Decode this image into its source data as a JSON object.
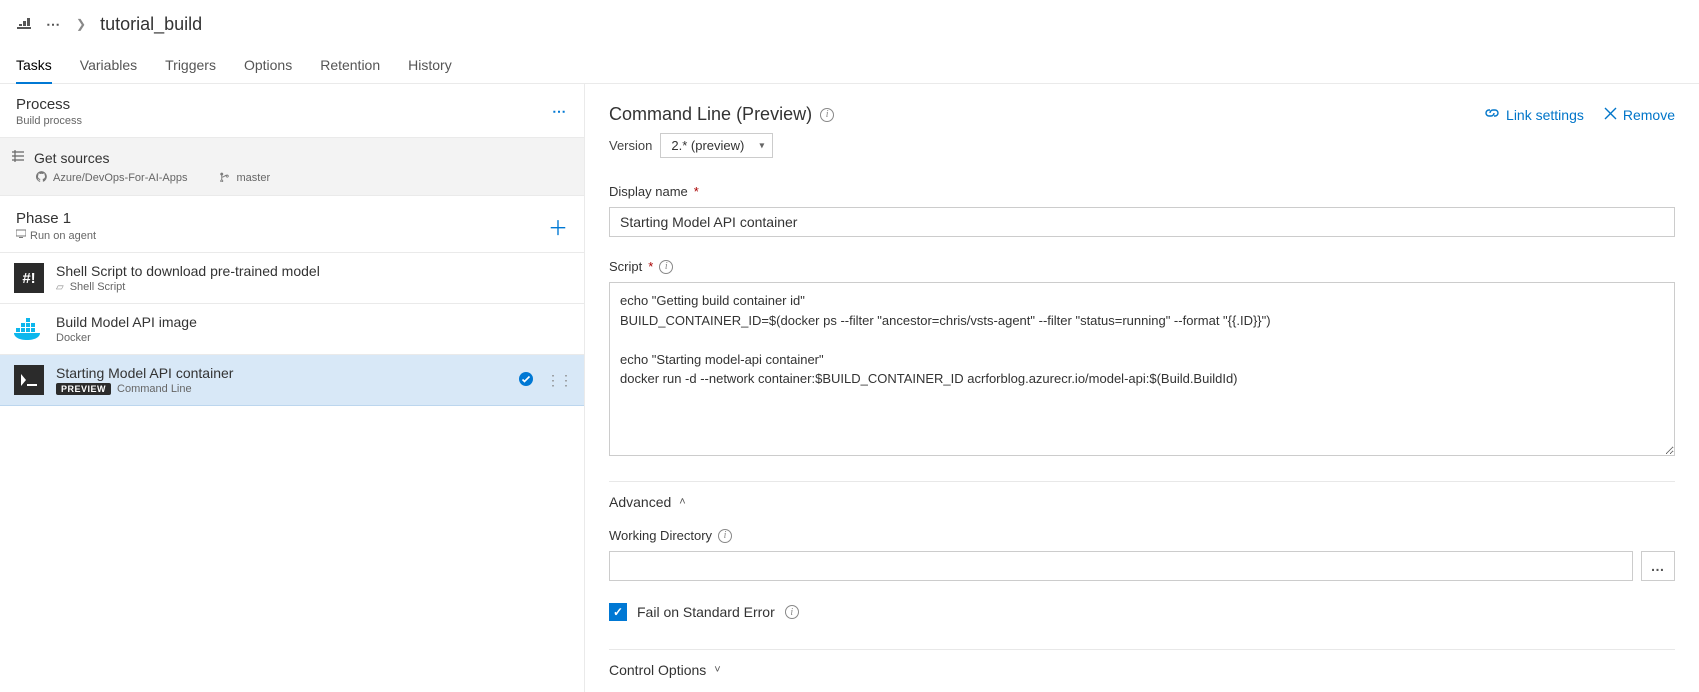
{
  "breadcrumb": {
    "title": "tutorial_build"
  },
  "tabs": [
    "Tasks",
    "Variables",
    "Triggers",
    "Options",
    "Retention",
    "History"
  ],
  "active_tab": "Tasks",
  "process": {
    "title": "Process",
    "subtitle": "Build process"
  },
  "sources": {
    "title": "Get sources",
    "repo": "Azure/DevOps-For-AI-Apps",
    "branch": "master"
  },
  "phase": {
    "title": "Phase 1",
    "subtitle": "Run on agent"
  },
  "tasks": [
    {
      "title": "Shell Script to download pre-trained model",
      "type": "Shell Script",
      "icon": "hash"
    },
    {
      "title": "Build Model API image",
      "type": "Docker",
      "icon": "docker"
    },
    {
      "title": "Starting Model API container",
      "type": "Command Line",
      "icon": "term",
      "preview": true,
      "selected": true
    }
  ],
  "detail": {
    "title": "Command Line (Preview)",
    "link_settings": "Link settings",
    "remove": "Remove",
    "version_label": "Version",
    "version_value": "2.* (preview)",
    "display_name_label": "Display name",
    "display_name_value": "Starting Model API container",
    "script_label": "Script",
    "script_value": "echo \"Getting build container id\"\nBUILD_CONTAINER_ID=$(docker ps --filter \"ancestor=chris/vsts-agent\" --filter \"status=running\" --format \"{{.ID}}\")\n\necho \"Starting model-api container\"\ndocker run -d --network container:$BUILD_CONTAINER_ID acrforblog.azurecr.io/model-api:$(Build.BuildId)",
    "advanced_label": "Advanced",
    "working_dir_label": "Working Directory",
    "working_dir_value": "",
    "fail_stderr_label": "Fail on Standard Error",
    "fail_stderr_checked": true,
    "control_options_label": "Control Options"
  },
  "preview_badge": "PREVIEW"
}
